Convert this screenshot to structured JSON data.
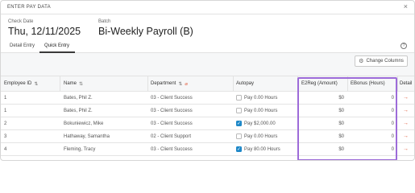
{
  "dialog": {
    "title": "ENTER PAY DATA"
  },
  "header": {
    "check_date_label": "Check Date",
    "check_date_value": "Thu, 12/11/2025",
    "batch_label": "Batch",
    "batch_value": "Bi-Weekly Payroll (B)"
  },
  "tabs": [
    {
      "label": "Detail Entry"
    },
    {
      "label": "Quick Entry"
    }
  ],
  "toolbar": {
    "change_columns_label": "Change Columns"
  },
  "table": {
    "columns": {
      "employee_id": "Employee ID",
      "name": "Name",
      "department": "Department",
      "autopay": "Autopay",
      "e2reg": "E2Reg (Amount)",
      "ebonus": "EBonus (Hours)",
      "detail": "Detail"
    },
    "rows": [
      {
        "id": "1",
        "name": "Bates, Phil Z.",
        "dept": "03 - Client Success",
        "autopay_checked": false,
        "autopay_label": "Pay 0.00 Hours",
        "e2reg": "$0",
        "ebonus": "0"
      },
      {
        "id": "1",
        "name": "Bates, Phil Z.",
        "dept": "03 - Client Success",
        "autopay_checked": false,
        "autopay_label": "Pay 0.00 Hours",
        "e2reg": "$0",
        "ebonus": "0"
      },
      {
        "id": "2",
        "name": "Bokuniewicz, Mike",
        "dept": "03 - Client Success",
        "autopay_checked": true,
        "autopay_label": "Pay $2,000.00",
        "e2reg": "$0",
        "ebonus": "0"
      },
      {
        "id": "3",
        "name": "Hathaway, Samantha",
        "dept": "02 - Client Support",
        "autopay_checked": false,
        "autopay_label": "Pay 0.00 Hours",
        "e2reg": "$0",
        "ebonus": "0"
      },
      {
        "id": "4",
        "name": "Fleming, Tracy",
        "dept": "03 - Client Success",
        "autopay_checked": true,
        "autopay_label": "Pay 80.00 Hours",
        "e2reg": "$0",
        "ebonus": "0"
      }
    ]
  },
  "colors": {
    "accent_orange": "#e05a3a",
    "checkbox_blue": "#1e88c8",
    "highlight_purple": "#9d6bd9"
  }
}
